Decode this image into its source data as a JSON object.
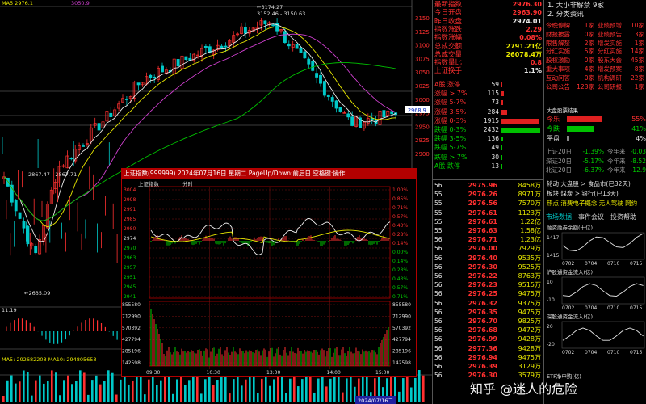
{
  "colors": {
    "up": "#ff3030",
    "down": "#00d000",
    "bg": "#000000",
    "popup_title_bg": "#b30000",
    "yellow": "#e8e800",
    "cyan": "#00c8c8"
  },
  "kline": {
    "top_annotations": {
      "ma_left": "MA5 2976.1",
      "ma_mid": "3050.9",
      "high_label": "3174.27",
      "range_label": "3152.46 - 3150.63",
      "low_label": "2635.09",
      "mid_label": "2867.47 - 2867.71",
      "last_marker": "2968.9"
    },
    "price_axis": [
      "3150",
      "3125",
      "3100",
      "3075",
      "3050",
      "3025",
      "3000",
      "2975",
      "2950",
      "2925",
      "2900"
    ],
    "indicator_labels": {
      "macd": "11.19",
      "volume": "MA5: 292682208  MA10: 294805658"
    },
    "date_tag": "2024/07/16二"
  },
  "quote_panel": {
    "labels": [
      "最新指数",
      "今日开盘",
      "昨日收盘",
      "指数涨跌",
      "指数涨幅",
      "总成交额",
      "总成交量",
      "指数量比",
      "上证换手"
    ],
    "values": [
      "2976.30",
      "2963.90",
      "2974.01",
      "2.29",
      "0.08%",
      "2791.21亿",
      "26078.4万",
      "0.8",
      "1.1%"
    ],
    "value_colors": [
      "red",
      "red",
      "white",
      "red",
      "red",
      "yellow",
      "yellow",
      "red",
      "white"
    ],
    "breadth_header": "A股 涨停",
    "breadth_rows": [
      {
        "label": "A股 涨停",
        "count": "59",
        "color": "red",
        "bar": 0.03
      },
      {
        "label": "涨幅 > 7%",
        "count": "115",
        "color": "red",
        "bar": 0.06
      },
      {
        "label": "涨幅 5-7%",
        "count": "73",
        "color": "red",
        "bar": 0.04
      },
      {
        "label": "涨幅 3-5%",
        "count": "284",
        "color": "red",
        "bar": 0.14
      },
      {
        "label": "涨幅 0-3%",
        "count": "1915",
        "color": "red",
        "bar": 0.96
      },
      {
        "label": "跌幅 0-3%",
        "count": "2432",
        "color": "green",
        "bar": 1.0
      },
      {
        "label": "跌幅 3-5%",
        "count": "136",
        "color": "green",
        "bar": 0.05
      },
      {
        "label": "跌幅 5-7%",
        "count": "49",
        "color": "green",
        "bar": 0.02
      },
      {
        "label": "跌幅 > 7%",
        "count": "30",
        "color": "green",
        "bar": 0.01
      },
      {
        "label": "A股 跌停",
        "count": "13",
        "color": "green",
        "bar": 0.01
      }
    ]
  },
  "right_panel": {
    "top_items": [
      "1. 大小非解禁 9家",
      "2. 分类资讯"
    ],
    "event_rows": [
      [
        "今晚停牌",
        "1家",
        "业绩预增",
        "10家"
      ],
      [
        "财报披露",
        "0家",
        "业绩预告",
        "3家"
      ],
      [
        "限售解禁",
        "2家",
        "增发实施",
        "1家"
      ],
      [
        "分红实施",
        "5家",
        "分红实施",
        "14家"
      ],
      [
        "股权激励",
        "0家",
        "股东大会",
        "45家"
      ],
      [
        "重大事项",
        "4家",
        "增发预案",
        "8家"
      ],
      [
        "互动问答",
        "0家",
        "机构调研",
        "22家"
      ],
      [
        "公司公告",
        "123家",
        "公司研报",
        "1家"
      ]
    ],
    "stats_title": "大盘股票结果",
    "stats_rows": [
      {
        "label": "今乐",
        "value": "55%",
        "color": "red",
        "bar": 0.55
      },
      {
        "label": "今跌",
        "value": "41%",
        "color": "green",
        "bar": 0.41
      },
      {
        "label": "平盘",
        "value": "4%",
        "color": "white",
        "bar": 0.04
      }
    ],
    "flow_rows": [
      {
        "label": "上证20日",
        "v1": "-1.39%",
        "l2": "今年来",
        "v2": "-0.03"
      },
      {
        "label": "深证20日",
        "v1": "-5.17%",
        "l2": "今年来",
        "v2": "-8.52"
      },
      {
        "label": "北证20日",
        "v1": "-6.37%",
        "l2": "今年来",
        "v2": "-12.9"
      }
    ],
    "sector_lines": [
      "轮动 大盘股 > 食品市(已32天)",
      "板块 煤炭 > 银行(已13天)",
      "热点 消费电子概念 无人驾驶 网约"
    ],
    "tabs": [
      "市场数据",
      "事件会议",
      "投资帮助"
    ],
    "mini_charts": [
      {
        "title": "融资融券余额(十亿)",
        "y_top": "1417",
        "y_bot": "1415",
        "x": [
          "0702",
          "0704",
          "0710",
          "0715"
        ]
      },
      {
        "title": "沪股通资金流入(亿)",
        "y_top": "10",
        "y_bot": "-10",
        "x": [
          "0702",
          "0704",
          "0710",
          "0715"
        ]
      },
      {
        "title": "深股通资金流入(亿)",
        "y_top": "20",
        "y_bot": "-20",
        "x": [
          "0702",
          "0704",
          "0710",
          "0715"
        ]
      }
    ],
    "bottom_label": "ETF净申购(亿)"
  },
  "tick_list": {
    "rows": [
      [
        "56",
        "2975.96",
        "8458万"
      ],
      [
        "55",
        "2976.26",
        "8971万"
      ],
      [
        "55",
        "2976.56",
        "7570万"
      ],
      [
        "55",
        "2976.61",
        "1123万"
      ],
      [
        "55",
        "2976.61",
        "1.22亿"
      ],
      [
        "55",
        "2976.63",
        "1.58亿"
      ],
      [
        "56",
        "2976.71",
        "1.23亿"
      ],
      [
        "56",
        "2976.00",
        "7929万"
      ],
      [
        "56",
        "2976.40",
        "9535万"
      ],
      [
        "56",
        "2976.30",
        "9525万"
      ],
      [
        "56",
        "2976.22",
        "8763万"
      ],
      [
        "56",
        "2976.23",
        "9515万"
      ],
      [
        "56",
        "2976.25",
        "9475万"
      ],
      [
        "56",
        "2976.32",
        "9375万"
      ],
      [
        "56",
        "2976.35",
        "9475万"
      ],
      [
        "56",
        "2976.70",
        "9825万"
      ],
      [
        "56",
        "2976.68",
        "9472万"
      ],
      [
        "56",
        "2976.99",
        "9428万"
      ],
      [
        "56",
        "2977.36",
        "9428万"
      ],
      [
        "56",
        "2976.94",
        "9475万"
      ],
      [
        "56",
        "2976.39",
        "3129万"
      ],
      [
        "56",
        "2976.30",
        "3579万"
      ]
    ]
  },
  "popup": {
    "title": "上证指数(999999) 2024年07月16日 星期二 PageUp/Down:前后日 空格键:操作",
    "subtitle_left": "上证指数",
    "subtitle_right": "分时",
    "price_ticks": [
      "3004",
      "2998",
      "2991",
      "2985",
      "2980",
      "2974",
      "2970",
      "2963",
      "2957",
      "2951",
      "2945",
      "2941"
    ],
    "pct_ticks": [
      "1.00%",
      "0.85%",
      "0.71%",
      "0.57%",
      "0.43%",
      "0.28%",
      "0.14%",
      "0.00%",
      "0.14%",
      "0.28%",
      "0.43%",
      "0.57%",
      "0.71%"
    ],
    "volume_ticks": [
      "855580",
      "712990",
      "570392",
      "427794",
      "285196",
      "142598"
    ],
    "time_ticks": [
      "09:30",
      "10:30",
      "13:00",
      "14:00",
      "15:00"
    ],
    "watermark": "知乎 @迷人的危险"
  }
}
